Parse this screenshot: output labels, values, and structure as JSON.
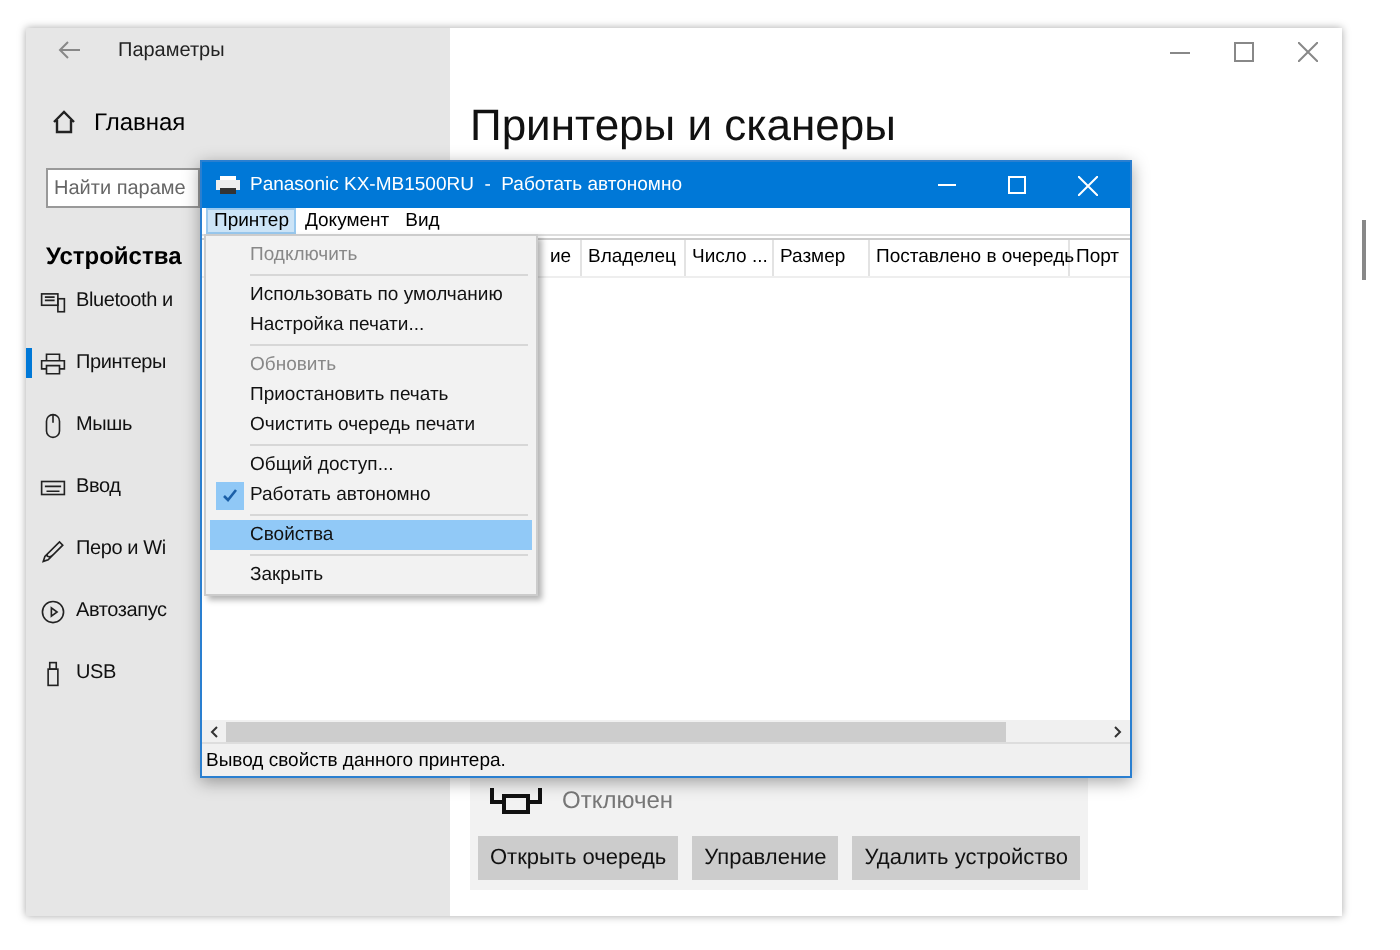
{
  "settings_window": {
    "title": "Параметры",
    "home": "Главная",
    "search": {
      "placeholder": "Найти параме"
    },
    "section": "Устройства",
    "sidebar": {
      "items": [
        {
          "label": "Bluetooth и",
          "selected": false
        },
        {
          "label": "Принтеры",
          "selected": true
        },
        {
          "label": "Мышь",
          "selected": false
        },
        {
          "label": "Ввод",
          "selected": false
        },
        {
          "label": "Перо и Wi",
          "selected": false
        },
        {
          "label": "Автозапус",
          "selected": false
        },
        {
          "label": "USB",
          "selected": false
        }
      ]
    },
    "page_title": "Принтеры и сканеры",
    "device": {
      "status": "Отключен",
      "buttons": [
        "Открыть очередь",
        "Управление",
        "Удалить устройство"
      ]
    }
  },
  "printer_window": {
    "title": "Panasonic KX-MB1500RU  -  Работать автономно",
    "menu": [
      {
        "label": "Принтер",
        "selected": true
      },
      {
        "label": "Документ",
        "selected": false
      },
      {
        "label": "Вид",
        "selected": false
      }
    ],
    "columns": [
      "ие",
      "Владелец",
      "Число ...",
      "Размер",
      "Поставлено в очередь",
      "Порт"
    ],
    "status_bar": "Вывод свойств данного принтера."
  },
  "dropdown": {
    "items": [
      {
        "kind": "item",
        "label": "Подключить",
        "disabled": true,
        "checked": false,
        "selected": false
      },
      {
        "kind": "separator"
      },
      {
        "kind": "item",
        "label": "Использовать по умолчанию",
        "disabled": false,
        "checked": false,
        "selected": false
      },
      {
        "kind": "item",
        "label": "Настройка печати...",
        "disabled": false,
        "checked": false,
        "selected": false
      },
      {
        "kind": "separator"
      },
      {
        "kind": "item",
        "label": "Обновить",
        "disabled": true,
        "checked": false,
        "selected": false
      },
      {
        "kind": "item",
        "label": "Приостановить печать",
        "disabled": false,
        "checked": false,
        "selected": false
      },
      {
        "kind": "item",
        "label": "Очистить очередь печати",
        "disabled": false,
        "checked": false,
        "selected": false
      },
      {
        "kind": "separator"
      },
      {
        "kind": "item",
        "label": "Общий доступ...",
        "disabled": false,
        "checked": false,
        "selected": false
      },
      {
        "kind": "item",
        "label": "Работать автономно",
        "disabled": false,
        "checked": true,
        "selected": false
      },
      {
        "kind": "separator"
      },
      {
        "kind": "item",
        "label": "Свойства",
        "disabled": false,
        "checked": false,
        "selected": true
      },
      {
        "kind": "separator"
      },
      {
        "kind": "item",
        "label": "Закрыть",
        "disabled": false,
        "checked": false,
        "selected": false
      }
    ]
  }
}
